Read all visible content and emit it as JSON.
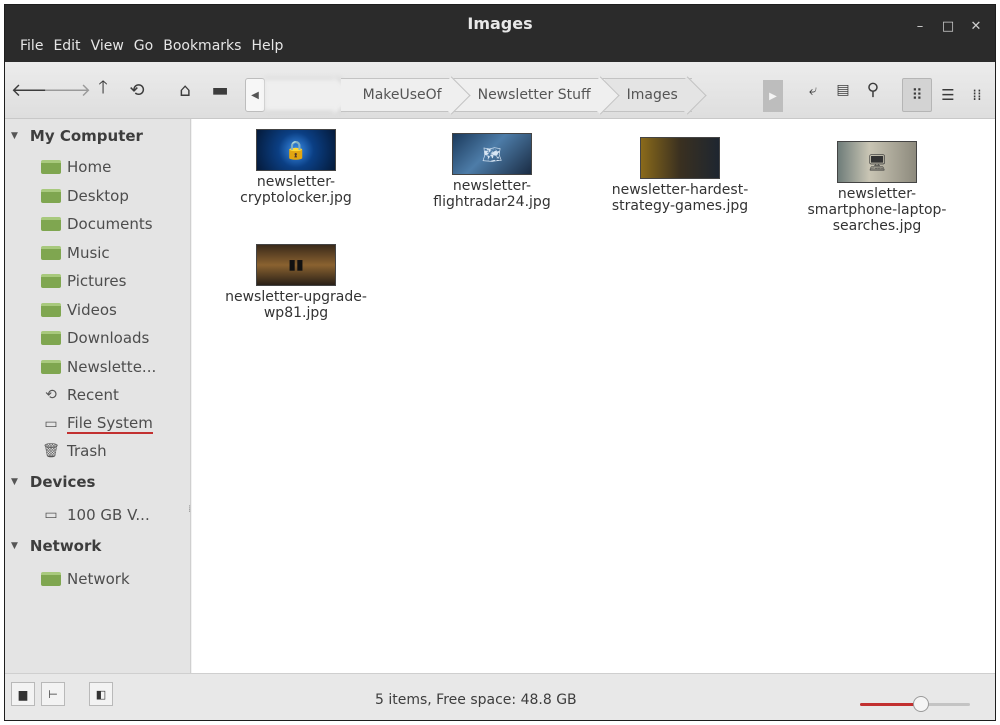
{
  "window": {
    "title": "Images"
  },
  "menu": [
    "File",
    "Edit",
    "View",
    "Go",
    "Bookmarks",
    "Help"
  ],
  "toolbar": {
    "back_icon": "arrow-left-icon",
    "forward_icon": "arrow-right-icon",
    "up_icon": "arrow-up-icon",
    "reload_icon": "reload-icon",
    "home_icon": "home-icon",
    "computer_icon": "computer-icon",
    "breadcrumbs": [
      "MakeUseOf",
      "Newsletter Stuff",
      "Images"
    ]
  },
  "sidebar": {
    "sections": [
      {
        "label": "My Computer",
        "items": [
          "Home",
          "Desktop",
          "Documents",
          "Music",
          "Pictures",
          "Videos",
          "Downloads",
          "Newslette...",
          "Recent",
          "File System",
          "Trash"
        ]
      },
      {
        "label": "Devices",
        "items": [
          "100 GB V..."
        ]
      },
      {
        "label": "Network",
        "items": [
          "Network"
        ]
      }
    ]
  },
  "files": [
    {
      "name_line1": "newsletter-",
      "name_line2": "cryptolocker.jpg",
      "name_line3": ""
    },
    {
      "name_line1": "newsletter-",
      "name_line2": "flightradar24.jpg",
      "name_line3": ""
    },
    {
      "name_line1": "newsletter-hardest-",
      "name_line2": "strategy-games.jpg",
      "name_line3": ""
    },
    {
      "name_line1": "newsletter-",
      "name_line2": "smartphone-laptop-",
      "name_line3": "searches.jpg"
    },
    {
      "name_line1": "newsletter-upgrade-",
      "name_line2": "wp81.jpg",
      "name_line3": ""
    }
  ],
  "status": {
    "text": "5 items, Free space: 48.8 GB",
    "zoom_fraction": 0.55
  },
  "colors": {
    "accent": "#c23030",
    "titlebar": "#2b2b2b",
    "folder": "#7fa650"
  }
}
